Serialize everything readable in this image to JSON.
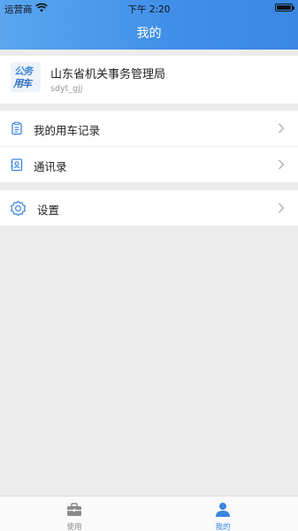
{
  "status_bar": {
    "carrier": "运营商",
    "time": "下午 2:20"
  },
  "header": {
    "title": "我的"
  },
  "profile": {
    "logo_line1": "公务",
    "logo_line2": "用车",
    "org_name": "山东省机关事务管理局",
    "account": "sdyt_gjj"
  },
  "menu": {
    "records_label": "我的用车记录",
    "contacts_label": "通讯录",
    "settings_label": "设置"
  },
  "tabbar": {
    "use_label": "使用",
    "mine_label": "我的",
    "active_color": "#3a86e0",
    "inactive_color": "#8a8a8a"
  },
  "icons": {
    "records": "clipboard-icon",
    "contacts": "contacts-book-icon",
    "settings": "gear-icon",
    "use": "briefcase-icon",
    "mine": "person-icon"
  }
}
